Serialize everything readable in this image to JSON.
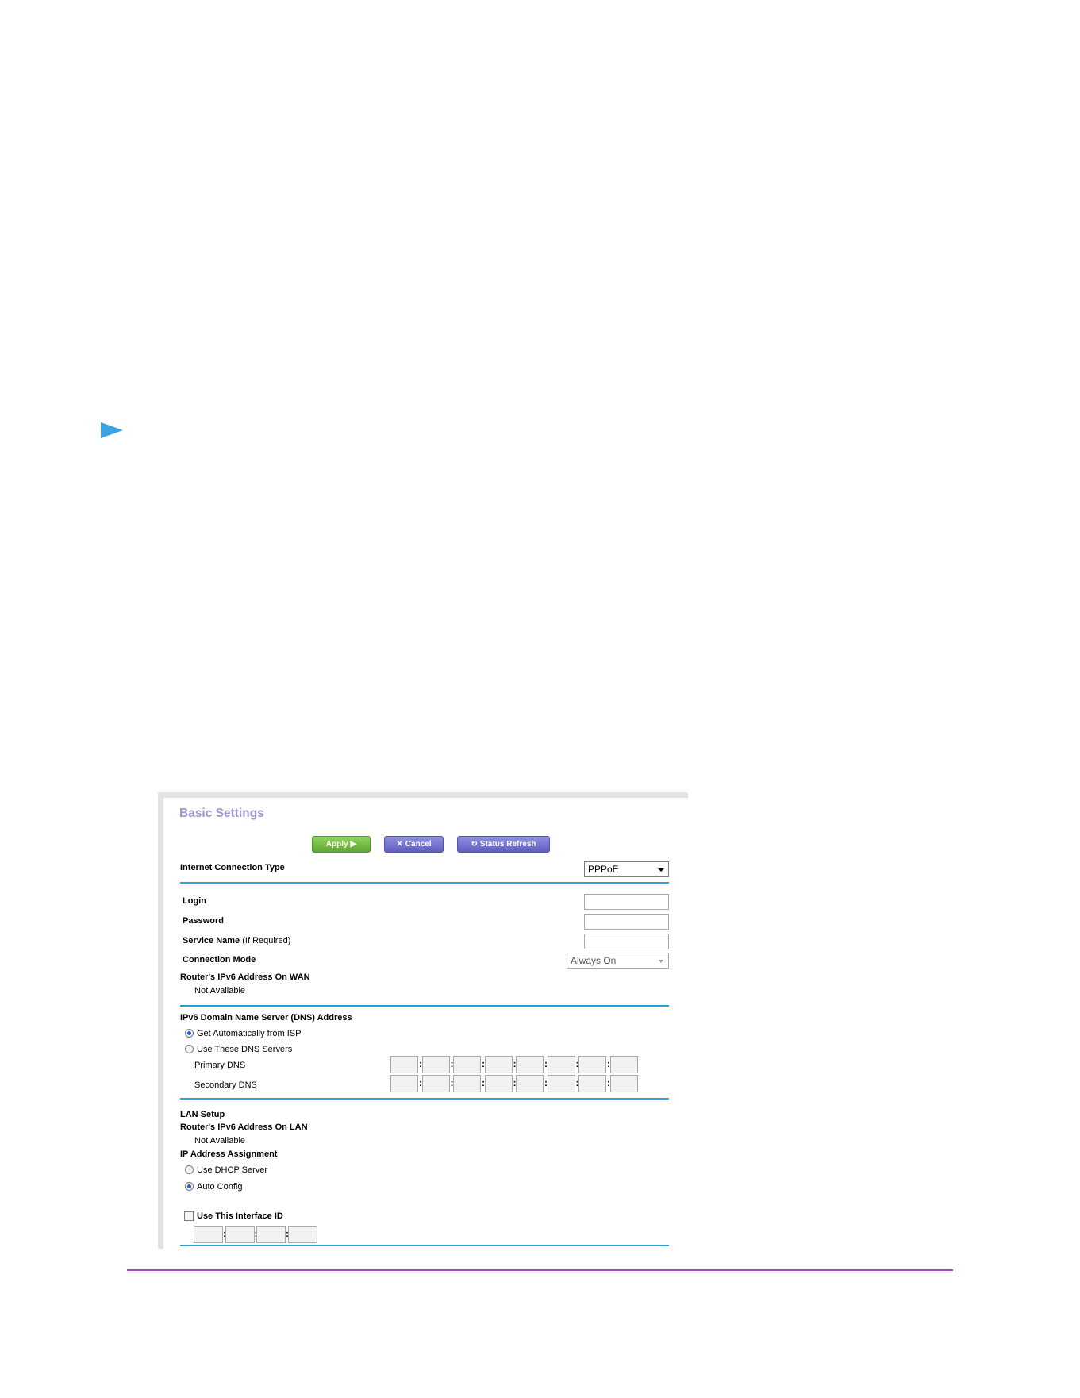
{
  "page": {
    "accent_blue": "#28a0d8",
    "accent_purple": "#a64ac9"
  },
  "screenshot": {
    "title": "Basic Settings",
    "buttons": {
      "apply": {
        "label": "Apply",
        "icon": "play-icon"
      },
      "cancel": {
        "label": "Cancel",
        "icon": "close-icon"
      },
      "refresh": {
        "label": "Status Refresh",
        "icon": "refresh-icon"
      }
    },
    "connection_type": {
      "label": "Internet Connection Type",
      "value": "PPPoE"
    },
    "login": {
      "label": "Login",
      "value": ""
    },
    "password": {
      "label": "Password",
      "value": ""
    },
    "service_name": {
      "label": "Service Name",
      "hint": "(If Required)",
      "value": ""
    },
    "connection_mode": {
      "label": "Connection Mode",
      "value": "Always On"
    },
    "wan_ipv6": {
      "label": "Router's IPv6 Address On WAN",
      "value": "Not Available"
    },
    "dns": {
      "heading": "IPv6 Domain Name Server (DNS) Address",
      "option_auto": "Get Automatically from ISP",
      "option_manual": "Use These DNS Servers",
      "selected": "auto",
      "primary_label": "Primary DNS",
      "secondary_label": "Secondary DNS",
      "segments": 8
    },
    "lan": {
      "heading": "LAN Setup",
      "lan_ipv6_label": "Router's IPv6 Address On LAN",
      "lan_ipv6_value": "Not Available",
      "assignment_label": "IP Address Assignment",
      "option_dhcp": "Use DHCP Server",
      "option_auto": "Auto Config",
      "selected": "auto",
      "interface_id_label": "Use This Interface ID",
      "interface_id_checked": false
    }
  }
}
